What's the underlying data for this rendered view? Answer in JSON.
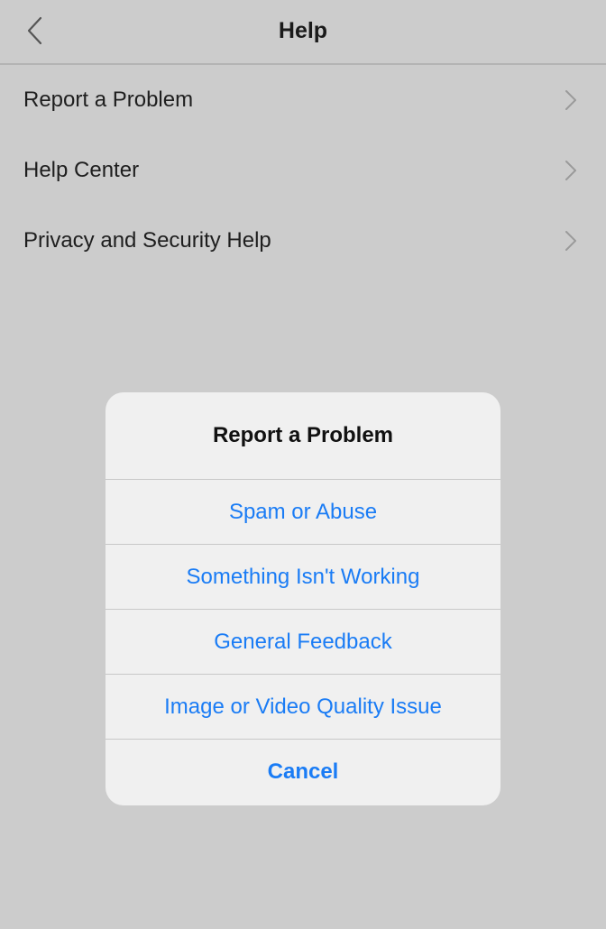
{
  "navbar": {
    "title": "Help",
    "back_icon": "chevron-left-icon"
  },
  "menu": {
    "items": [
      {
        "label": "Report a Problem",
        "icon": "chevron-right-icon"
      },
      {
        "label": "Help Center",
        "icon": "chevron-right-icon"
      },
      {
        "label": "Privacy and Security Help",
        "icon": "chevron-right-icon"
      }
    ]
  },
  "alert": {
    "title": "Report a Problem",
    "actions": [
      {
        "label": "Spam or Abuse"
      },
      {
        "label": "Something Isn't Working"
      },
      {
        "label": "General Feedback"
      },
      {
        "label": "Image or Video Quality Issue"
      }
    ],
    "cancel_label": "Cancel"
  },
  "colors": {
    "background_dimmed": "#cccccc",
    "alert_background": "#f0f0f0",
    "action_blue": "#1a7cf5",
    "text_primary": "#1e1e1e",
    "chevron": "#9a9a9a"
  }
}
